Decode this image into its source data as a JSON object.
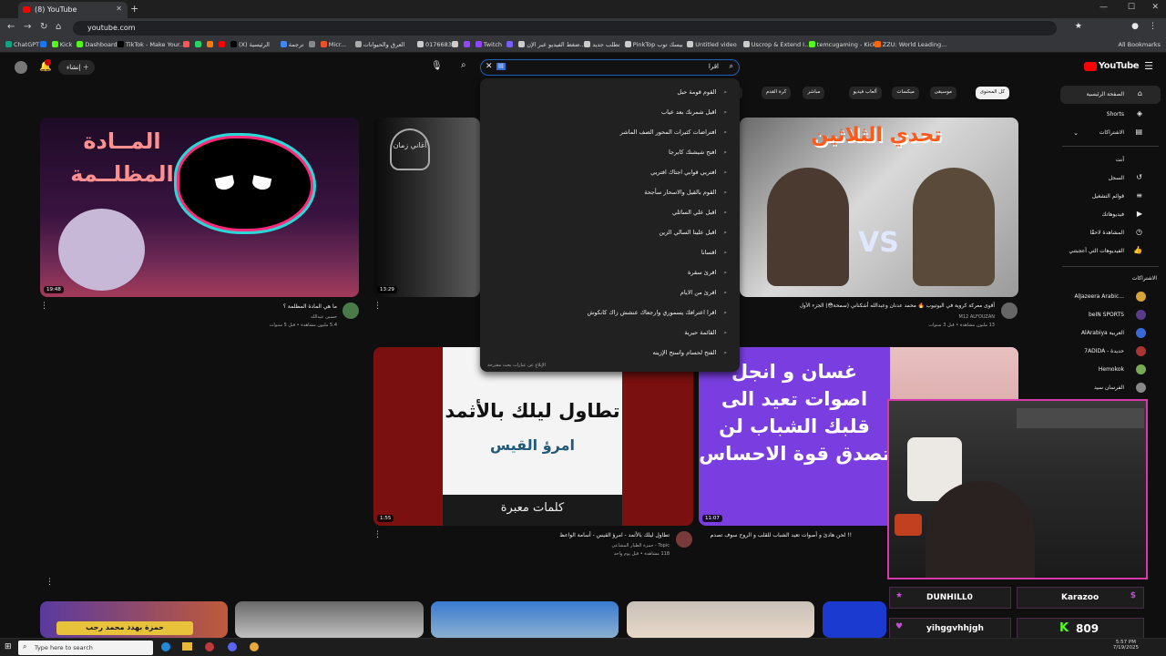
{
  "browser": {
    "tab_title": "(8) YouTube",
    "url": "youtube.com",
    "bookmarks": [
      {
        "label": "ChatGPT",
        "color": "#10a37f"
      },
      {
        "label": "",
        "color": "#1877f2"
      },
      {
        "label": "Kick",
        "color": "#53fc18"
      },
      {
        "label": "Dashboard",
        "color": "#53fc18"
      },
      {
        "label": "TikTok - Make Your...",
        "color": "#000000"
      },
      {
        "label": "",
        "color": "#ff5555"
      },
      {
        "label": "",
        "color": "#25d366"
      },
      {
        "label": "",
        "color": "#ff7a00"
      },
      {
        "label": "",
        "color": "#ff0000"
      },
      {
        "label": "(X) الرئيسية",
        "color": "#000000"
      },
      {
        "label": "ترجمة",
        "color": "#4285f4"
      },
      {
        "label": "",
        "color": "#888888"
      },
      {
        "label": "Micr...",
        "color": "#f25022"
      },
      {
        "label": "العرق والحيوانات",
        "color": "#aaaaaa"
      },
      {
        "label": "0176683",
        "color": "#cccccc"
      },
      {
        "label": "",
        "color": "#cccccc"
      },
      {
        "label": "",
        "color": "#9146ff"
      },
      {
        "label": "Twitch",
        "color": "#9146ff"
      },
      {
        "label": "",
        "color": "#7b5cff"
      },
      {
        "label": "ضغط الفيديو عبر الإن...",
        "color": "#cccccc"
      },
      {
        "label": "تطلب جديد",
        "color": "#cccccc"
      },
      {
        "label": "PinkTop بيسك توب",
        "color": "#cccccc"
      },
      {
        "label": "Untitled video",
        "color": "#cccccc"
      },
      {
        "label": "Uscrop & Extend I...",
        "color": "#cccccc"
      },
      {
        "label": "temcugaming - Kick...",
        "color": "#53fc18"
      },
      {
        "label": "ZZU: World Leading...",
        "color": "#ff6600"
      }
    ],
    "all_bookmarks": "All Bookmarks"
  },
  "header": {
    "logo_text": "YouTube",
    "create_label": "إنشاء",
    "search_query": "اقرا",
    "search_selected": "ااا",
    "notif_count": "8"
  },
  "suggestions": [
    "القوم قومة حبل",
    "اقبل شمرنك بعد عياب",
    "افتراضات كثيرات المحور الصف الماشر",
    "افتح شيشنك كابرجا",
    "افتريي قوابي اجتاك افتريي",
    "القوم بالقيل والاسحار سأجحة",
    "اقبل علي السائلي",
    "اقبل علينا السالي الزين",
    "اقسانا",
    "اقرئ سقرة",
    "اقرئ من الايام",
    "اقرا اعترافك يسموري وارجعاك عنشش زاك كانكوش",
    "القائمة حيرية",
    "الفتح لحسام واستح الإزينه"
  ],
  "report_text": "الإبلاغ عن عبارات بحث مقترحة",
  "chips": [
    "كل المحتوى",
    "موسيقى",
    "ميكسات",
    "ألعاب فيديو",
    "مباشر",
    "كرة القدم",
    "ألعاب مفامرات وحركة",
    "تم تحميلها مؤخرًا"
  ],
  "sidebar": {
    "home": "الصفحة الرئيسية",
    "shorts": "Shorts",
    "subs": "الاشتراكات",
    "you": "أنت",
    "history": "السجل",
    "playlists": "قوائم التشغيل",
    "your_videos": "فيديوهاتك",
    "watch_later": "المشاهدة لاحقًا",
    "liked": "الفيديوهات التي أعجبتني",
    "subs_header": "الاشتراكات",
    "channels": [
      {
        "name": "AlJazeera Arabic...",
        "color": "#d8a23a"
      },
      {
        "name": "beIN SPORTS",
        "color": "#5a3a8a"
      },
      {
        "name": "AlArabiya العربية",
        "color": "#3a6ad8"
      },
      {
        "name": "7ADIDA - حديدة",
        "color": "#a33"
      },
      {
        "name": "Hemokok",
        "color": "#7a5"
      },
      {
        "name": "الفرسان سيد",
        "color": "#888"
      }
    ]
  },
  "videos": [
    {
      "duration": "19:48",
      "title": "ما هي المادة المظلمة ؟",
      "channel": "حسين عبدالله",
      "meta": "5.4 مليون مشاهدة • قبل 5 سنوات",
      "thumb_text": "المــادة المظلــمة"
    },
    {
      "duration": "13:29",
      "title": "",
      "channel": "",
      "meta": "",
      "thumb_text": "أغاني زمان"
    },
    {
      "duration": "",
      "title": "أقوى معركة كروية في اليوتيوب 🔥 محمد عدنان وعبدالله أشكناني (سمحة😳) الجزء الأول",
      "channel": "M12 ALFOUZAN",
      "meta": "13 مليون مشاهدة • قبل 3 سنوات",
      "thumb_text": "تحدي الثلاثين"
    },
    {
      "duration": "1:55",
      "title": "تطاول ليلك بالأثمد - امرؤ القيس - أسامة الواعظ",
      "channel": "Topic - حمزة الطيار المشاعي",
      "meta": "118 مشاهدة • قبل يوم واحد",
      "thumb_text": "تطاول ليلك بالأثمد"
    },
    {
      "duration": "11:07",
      "title": "!! لحن هادئ و أصوات تعيد الشباب للقلب و الروح سوف تصدم",
      "channel": "",
      "meta": "",
      "thumb_text": "غسان و انجل اصوات تعيد الى قلبك الشباب لن تصدق قوة الاحساس"
    }
  ],
  "thumb_sub": {
    "author": "امرؤ القيس",
    "words": "كلمات معبرة",
    "name_pill": "حمزة بهدد محمد رجب"
  },
  "webcam": {
    "user1": "DUNHILL0",
    "user2": "Karazoo",
    "user3": "yihggvhhjgh",
    "kick_count": "809"
  },
  "taskbar": {
    "search_placeholder": "Type here to search",
    "time": "5:57 PM",
    "date": "7/19/2025"
  }
}
